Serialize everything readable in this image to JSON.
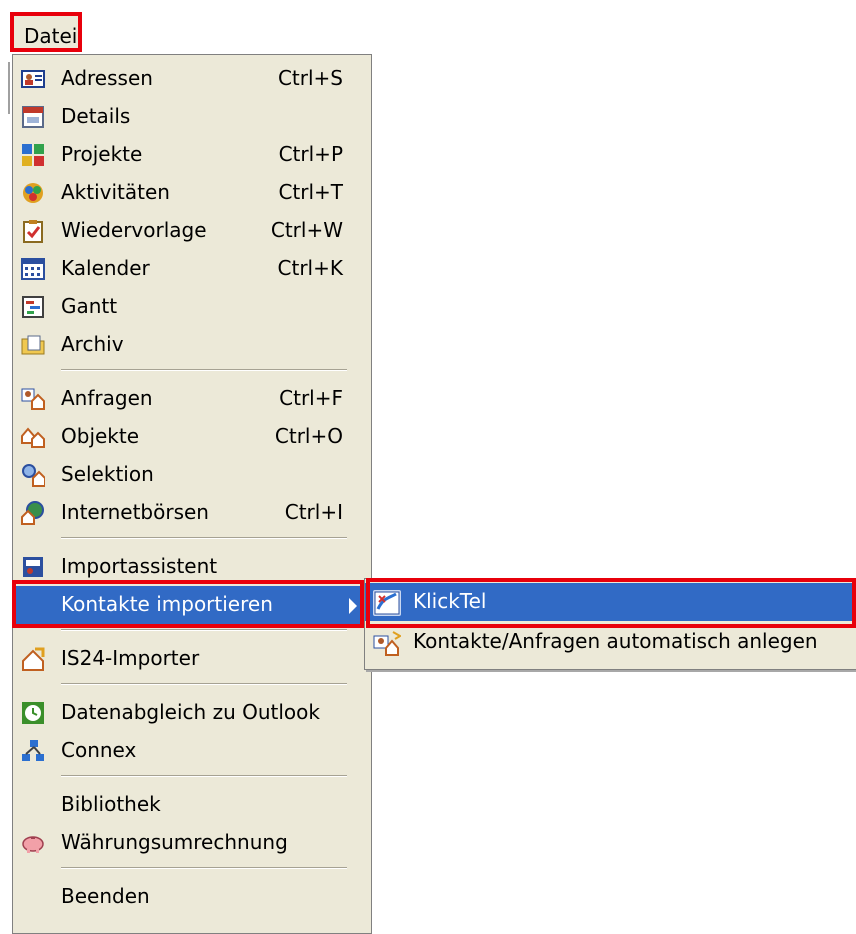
{
  "menubar": {
    "datei": "Datei"
  },
  "menu": {
    "items": [
      {
        "label": "Adressen",
        "shortcut": "Ctrl+S",
        "icon": "address-card-icon"
      },
      {
        "label": "Details",
        "shortcut": "",
        "icon": "details-window-icon"
      },
      {
        "label": "Projekte",
        "shortcut": "Ctrl+P",
        "icon": "projects-icon"
      },
      {
        "label": "Aktivitäten",
        "shortcut": "Ctrl+T",
        "icon": "activities-icon"
      },
      {
        "label": "Wiedervorlage",
        "shortcut": "Ctrl+W",
        "icon": "clipboard-check-icon"
      },
      {
        "label": "Kalender",
        "shortcut": "Ctrl+K",
        "icon": "calendar-icon"
      },
      {
        "label": "Gantt",
        "shortcut": "",
        "icon": "gantt-icon"
      },
      {
        "label": "Archiv",
        "shortcut": "",
        "icon": "archive-folder-icon"
      },
      {
        "label": "Anfragen",
        "shortcut": "Ctrl+F",
        "icon": "inquiries-icon"
      },
      {
        "label": "Objekte",
        "shortcut": "Ctrl+O",
        "icon": "houses-icon"
      },
      {
        "label": "Selektion",
        "shortcut": "",
        "icon": "selection-icon"
      },
      {
        "label": "Internetbörsen",
        "shortcut": "Ctrl+I",
        "icon": "globe-house-icon"
      },
      {
        "label": "Importassistent",
        "shortcut": "",
        "icon": "import-assistant-icon"
      },
      {
        "label": "Kontakte importieren",
        "shortcut": "",
        "icon": ""
      },
      {
        "label": "IS24-Importer",
        "shortcut": "",
        "icon": "is24-importer-icon"
      },
      {
        "label": "Datenabgleich zu Outlook",
        "shortcut": "",
        "icon": "sync-clock-icon"
      },
      {
        "label": "Connex",
        "shortcut": "",
        "icon": "network-icon"
      },
      {
        "label": "Bibliothek",
        "shortcut": "",
        "icon": ""
      },
      {
        "label": "Währungsumrechnung",
        "shortcut": "",
        "icon": "piggy-bank-icon"
      },
      {
        "label": "Beenden",
        "shortcut": "",
        "icon": ""
      }
    ]
  },
  "submenu": {
    "items": [
      {
        "label": "KlickTel",
        "icon": "klicktel-icon"
      },
      {
        "label": "Kontakte/Anfragen automatisch anlegen",
        "icon": "auto-create-contacts-icon"
      }
    ]
  },
  "colors": {
    "menu_bg": "#ece9d8",
    "highlight": "#316ac5",
    "annotation": "#e8000b"
  }
}
